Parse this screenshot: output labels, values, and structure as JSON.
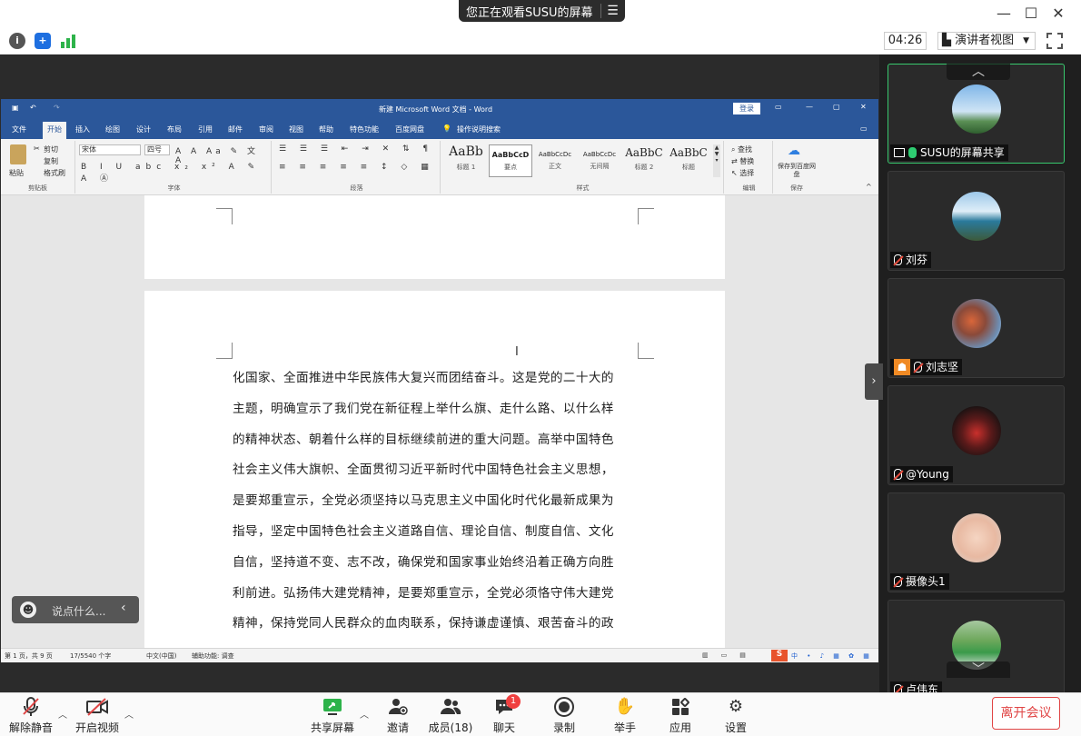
{
  "banner": {
    "text": "您正在观看SUSU的屏幕",
    "menu_icon": "list-icon"
  },
  "window_controls": {
    "minimize": "—",
    "maximize": "☐",
    "close": "✕"
  },
  "toolbar": {
    "timer": "04:26",
    "view_mode": "演讲者视图",
    "icons": [
      "info-icon",
      "shield-icon",
      "signal-icon",
      "fullscreen-icon"
    ]
  },
  "word": {
    "title": "新建 Microsoft Word 文档 - Word",
    "login": "登录",
    "tabs": [
      "文件",
      "开始",
      "插入",
      "绘图",
      "设计",
      "布局",
      "引用",
      "邮件",
      "审阅",
      "视图",
      "帮助",
      "特色功能",
      "百度网盘",
      "操作说明搜索"
    ],
    "active_tab": "开始",
    "ribbon": {
      "clipboard": {
        "paste": "粘贴",
        "cut": "剪切",
        "copy": "复制",
        "format_painter": "格式刷",
        "label": "剪贴板"
      },
      "font": {
        "family": "宋体",
        "size": "四号",
        "label": "字体"
      },
      "paragraph": {
        "label": "段落"
      },
      "styles": {
        "items": [
          {
            "preview": "AaBb",
            "name": "标题 1"
          },
          {
            "preview": "AaBbCcD",
            "name": "要点"
          },
          {
            "preview": "AaBbCcDc",
            "name": "正文"
          },
          {
            "preview": "AaBbCcDc",
            "name": "无间隔"
          },
          {
            "preview": "AaBbC",
            "name": "标题 2"
          },
          {
            "preview": "AaBbC",
            "name": "标题"
          }
        ],
        "label": "样式"
      },
      "editing": {
        "find": "查找",
        "replace": "替换",
        "select": "选择",
        "label": "编辑"
      },
      "save": {
        "button": "保存到百度网盘",
        "label": "保存"
      }
    },
    "doc_lines": [
      "化国家、全面推进中华民族伟大复兴而团结奋斗。这是党的二十大的",
      "主题，明确宣示了我们党在新征程上举什么旗、走什么路、以什么样",
      "的精神状态、朝着什么样的目标继续前进的重大问题。高举中国特色",
      "社会主义伟大旗帜、全面贯彻习近平新时代中国特色社会主义思想，",
      "是要郑重宣示，全党必须坚持以马克思主义中国化时代化最新成果为",
      "指导，坚定中国特色社会主义道路自信、理论自信、制度自信、文化",
      "自信，坚持道不变、志不改，确保党和国家事业始终沿着正确方向胜",
      "利前进。弘扬伟大建党精神，是要郑重宣示，全党必须恪守伟大建党",
      "精神，保持党同人民群众的血肉联系，保持谦虚谨慎、艰苦奋斗的政"
    ],
    "status": {
      "page": "第 1 页，共 9 页",
      "words": "17/5540 个字",
      "lang": "中文(中国)",
      "accessibility": "辅助功能: 调查"
    }
  },
  "chat": {
    "placeholder": "说点什么..."
  },
  "participants": [
    {
      "name": "SUSU的屏幕共享",
      "mic": "on",
      "active": true
    },
    {
      "name": "刘芬",
      "mic": "off",
      "active": false
    },
    {
      "name": "刘志坚",
      "mic": "off",
      "active": false
    },
    {
      "name": "@Young",
      "mic": "off",
      "active": false
    },
    {
      "name": "摄像头1",
      "mic": "off",
      "active": false
    },
    {
      "name": "卢伟东",
      "mic": "off",
      "active": false
    }
  ],
  "bottom": {
    "unmute": "解除静音",
    "video": "开启视频",
    "share": "共享屏幕",
    "invite": "邀请",
    "members": "成员(18)",
    "chat": "聊天",
    "chat_badge": "1",
    "record": "录制",
    "raise_hand": "举手",
    "apps": "应用",
    "settings": "设置",
    "leave": "离开会议"
  }
}
